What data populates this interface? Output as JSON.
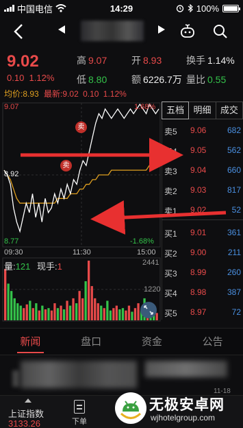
{
  "status_bar": {
    "carrier": "中国电信",
    "time": "14:29",
    "battery": "100%"
  },
  "header": {
    "back_icon": "back-icon",
    "prev_icon": "prev-arrow-icon",
    "next_icon": "next-arrow-icon"
  },
  "quote": {
    "price": "9.02",
    "change": "0.10",
    "change_pct": "1.12%",
    "high_label": "高",
    "high": "9.07",
    "open_label": "开",
    "open": "8.93",
    "turnover_label": "换手",
    "turnover": "1.14%",
    "low_label": "低",
    "low": "8.80",
    "amount_label": "额",
    "amount": "6226.7万",
    "volume_ratio_label": "量比",
    "volume_ratio": "0.55"
  },
  "intraday": {
    "avg_label": "均价:",
    "avg": "8.93",
    "latest_label": "最新:",
    "latest": "9.02",
    "latest_chg": "0.10",
    "latest_pct": "1.12%",
    "y_top": "9.07",
    "y_mid": "8.92",
    "y_bottom": "8.77",
    "pct_top": "1.68%",
    "pct_bottom": "-1.68%",
    "time_start": "09:30",
    "time_mid": "11:30",
    "time_end": "15:00",
    "sell_marker": "卖",
    "vol_label": "量:",
    "vol": "121",
    "hand_label": "现手:",
    "hand": "1",
    "vol_top": "2441",
    "vol_mid": "1220"
  },
  "chart_data": {
    "type": "line",
    "title": "",
    "xlabel": "",
    "ylabel": "",
    "x_ticks": [
      "09:30",
      "11:30",
      "15:00"
    ],
    "ylim": [
      8.77,
      9.07
    ],
    "series": [
      {
        "values": [
          8.93,
          8.92,
          8.9,
          8.85,
          8.82,
          8.8,
          8.83,
          8.86,
          8.84,
          8.88,
          8.83,
          8.86,
          8.82,
          8.87,
          8.84,
          8.85,
          8.88,
          8.86,
          8.89,
          8.87,
          8.9,
          8.88,
          8.91,
          8.9,
          8.93,
          8.95,
          8.94,
          8.97,
          9.0,
          9.03,
          9.05,
          9.04,
          9.06,
          9.05,
          9.04,
          9.05,
          9.06,
          9.05,
          9.04,
          9.05,
          9.06,
          9.05,
          9.06,
          9.07,
          9.06,
          9.05,
          9.07,
          9.06,
          9.05,
          9.06
        ]
      },
      {
        "values": [
          8.93,
          8.92,
          8.91,
          8.89,
          8.87,
          8.86,
          8.86,
          8.86,
          8.86,
          8.86,
          8.86,
          8.86,
          8.86,
          8.86,
          8.86,
          8.86,
          8.86,
          8.87,
          8.87,
          8.87,
          8.87,
          8.88,
          8.88,
          8.88,
          8.89,
          8.89,
          8.9,
          8.9,
          8.91,
          8.91,
          8.92,
          8.92,
          8.92,
          8.92,
          8.93,
          8.93,
          8.93,
          8.93,
          8.93,
          8.93,
          8.93,
          8.93,
          8.93,
          8.93,
          8.93,
          8.93,
          8.94,
          8.94,
          8.94,
          8.94
        ]
      }
    ],
    "volume": [
      2100,
      1500,
      1200,
      900,
      700,
      600,
      500,
      650,
      800,
      500,
      700,
      400,
      600,
      450,
      500,
      400,
      700,
      500,
      600,
      450,
      800,
      600,
      900,
      700,
      1200,
      900,
      1600,
      2441,
      1400,
      900,
      700,
      600,
      500,
      800,
      400,
      500,
      600,
      450,
      500,
      400,
      600,
      350,
      500,
      700,
      400,
      900,
      600,
      500,
      400,
      300
    ]
  },
  "orderbook": {
    "tabs": [
      "五档",
      "明细",
      "成交"
    ],
    "rows": [
      {
        "label": "卖5",
        "price": "9.06",
        "vol": "682",
        "side": "sell"
      },
      {
        "label": "卖4",
        "price": "9.05",
        "vol": "562",
        "side": "sell"
      },
      {
        "label": "卖3",
        "price": "9.04",
        "vol": "660",
        "side": "sell"
      },
      {
        "label": "卖2",
        "price": "9.03",
        "vol": "817",
        "side": "sell"
      },
      {
        "label": "卖1",
        "price": "9.02",
        "vol": "52",
        "side": "sell"
      },
      {
        "label": "买1",
        "price": "9.01",
        "vol": "361",
        "side": "buy"
      },
      {
        "label": "买2",
        "price": "9.00",
        "vol": "211",
        "side": "buy"
      },
      {
        "label": "买3",
        "price": "8.99",
        "vol": "260",
        "side": "buy"
      },
      {
        "label": "买4",
        "price": "8.98",
        "vol": "387",
        "side": "buy"
      },
      {
        "label": "买5",
        "price": "8.97",
        "vol": "72",
        "side": "buy"
      }
    ]
  },
  "bottom_tabs": [
    "新闻",
    "盘口",
    "资金",
    "公告"
  ],
  "news": {
    "time": "11-18"
  },
  "bottom_bar": {
    "index_name": "上证指数",
    "index_value": "3133.26",
    "order_label": "下单"
  },
  "watermark": {
    "text": "无极安卓网",
    "url": "wjhotelgroup.com"
  },
  "colors": {
    "up": "#e84a4a",
    "down": "#34c24a",
    "price_line": "#ffffff",
    "avg_line": "#e0a020",
    "vol_blue": "#4a90e2",
    "annot_arrow": "#e83030"
  }
}
